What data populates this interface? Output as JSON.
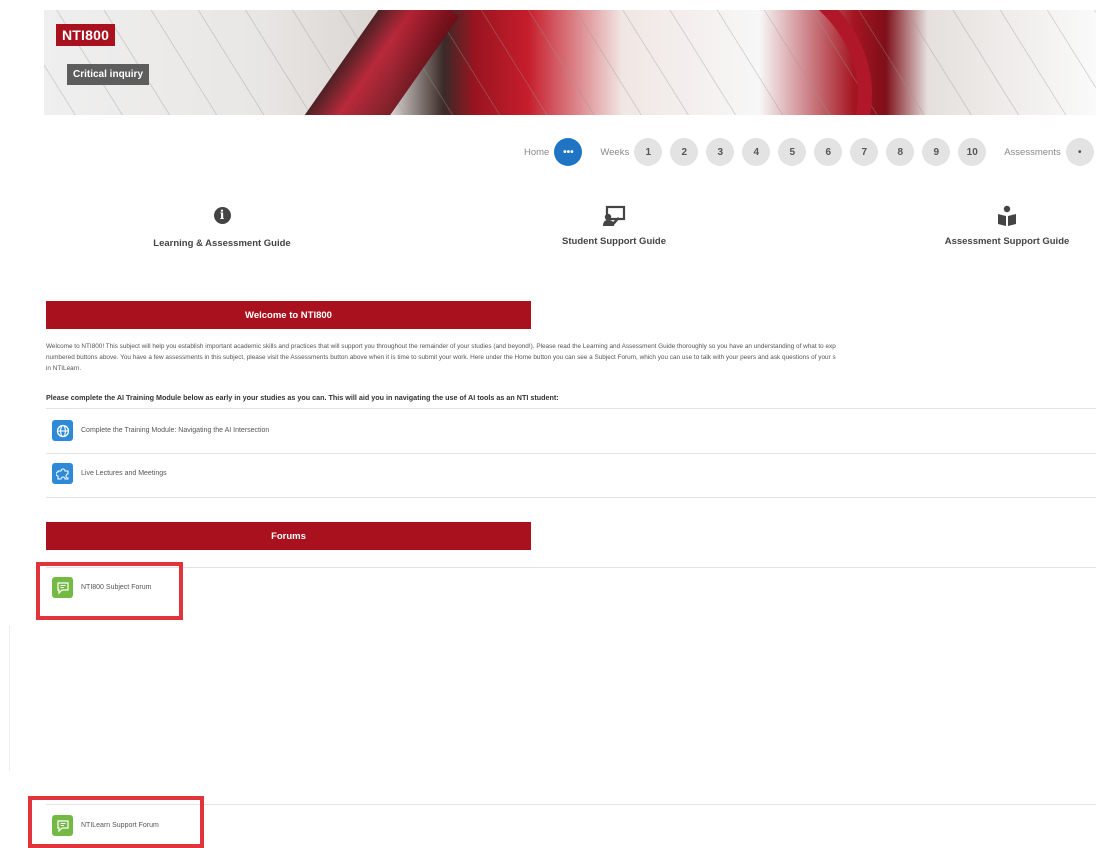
{
  "banner": {
    "course_code": "NTI800",
    "course_name": "Critical inquiry"
  },
  "nav": {
    "home_label": "Home",
    "home_button": "•••",
    "weeks_label": "Weeks",
    "weeks": [
      "1",
      "2",
      "3",
      "4",
      "5",
      "6",
      "7",
      "8",
      "9",
      "10"
    ],
    "assessments_label": "Assessments",
    "assessments_button": "•"
  },
  "guides": [
    {
      "label": "Learning & Assessment Guide",
      "icon": "info-icon"
    },
    {
      "label": "Student Support Guide",
      "icon": "presentation-icon"
    },
    {
      "label": "Assessment Support Guide",
      "icon": "reading-person-icon"
    }
  ],
  "welcome": {
    "header": "Welcome to NTI800",
    "lines": [
      "Welcome to NTI800! This subject will help you establish important academic skills and practices that will support you throughout the remainder of your studies (and beyond!). Please read the Learning and Assessment Guide thoroughly so you have an understanding of what to exp",
      "numbered buttons above. You have a few assessments in this subject, please visit the Assessments button above when it is time to submit your work. Here under the Home button you can see a Subject Forum, which you can use to talk with your peers and ask questions of your s",
      "in NTILearn."
    ],
    "ai_note": "Please complete the AI Training Module below as early in your studies as you can. This will aid you in navigating the use of AI tools as an NTI student:"
  },
  "activities": [
    {
      "label": "Complete the Training Module: Navigating the AI Intersection",
      "icon": "globe-icon"
    },
    {
      "label": "Live Lectures and Meetings",
      "icon": "puzzle-icon"
    }
  ],
  "forums": {
    "header": "Forums",
    "items": [
      {
        "label": "NTI800 Subject Forum",
        "icon": "forum-icon"
      },
      {
        "label": "NTILearn Support Forum",
        "icon": "forum-icon"
      }
    ]
  },
  "colors": {
    "brand_red": "#a8111d",
    "active_blue": "#1f75c4",
    "forum_green": "#73b944",
    "activity_blue": "#2e8ad8",
    "highlight_red": "#e0343c"
  }
}
